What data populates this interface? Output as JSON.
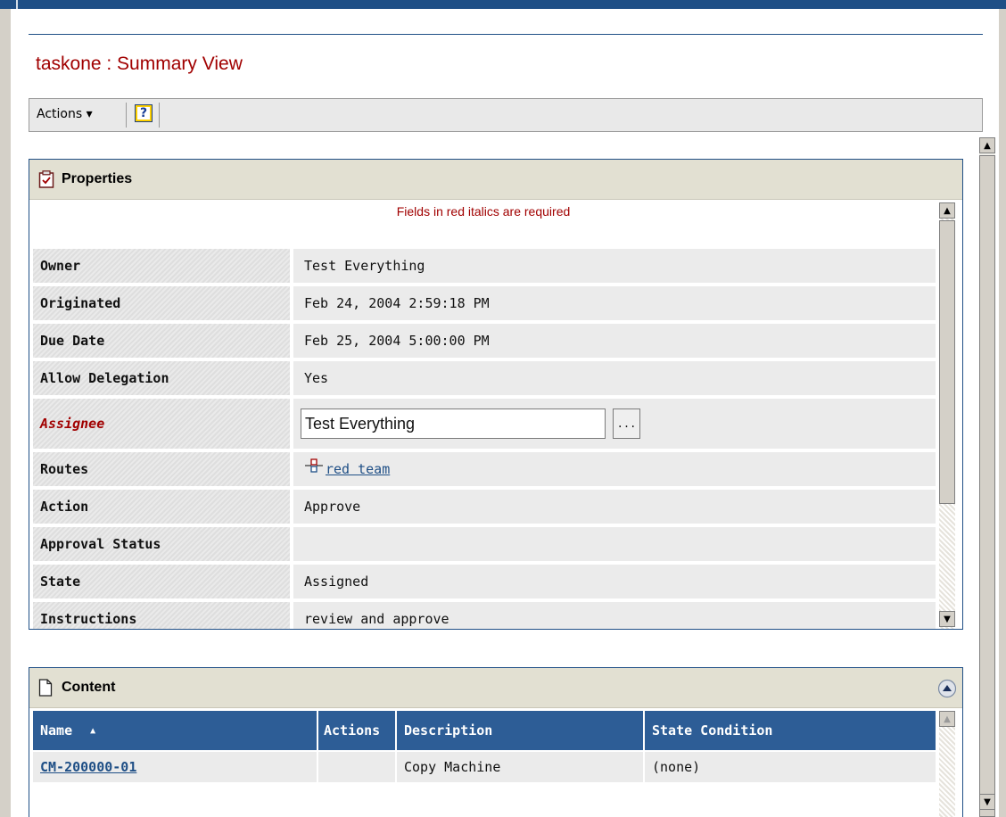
{
  "page": {
    "title": "taskone : Summary View"
  },
  "toolbar": {
    "actions_label": "Actions ▾",
    "help_label": "?"
  },
  "properties": {
    "title": "Properties",
    "required_note": "Fields in red italics are required",
    "rows": [
      {
        "label": "Owner",
        "value": "Test Everything"
      },
      {
        "label": "Originated",
        "value": "Feb 24, 2004 2:59:18 PM"
      },
      {
        "label": "Due Date",
        "value": "Feb 25, 2004 5:00:00 PM"
      },
      {
        "label": "Allow Delegation",
        "value": "Yes"
      },
      {
        "label": "Assignee",
        "value": "Test Everything",
        "required": true
      },
      {
        "label": "Routes",
        "value": "red team"
      },
      {
        "label": "Action",
        "value": "Approve"
      },
      {
        "label": "Approval Status",
        "value": ""
      },
      {
        "label": "State",
        "value": "Assigned"
      },
      {
        "label": "Instructions",
        "value": "review and approve"
      }
    ],
    "assignee_button": "..."
  },
  "content": {
    "title": "Content",
    "columns": [
      "Name",
      "Actions",
      "Description",
      "State Condition"
    ],
    "sort_indicator": "▲",
    "rows": [
      {
        "name": "CM-200000-01",
        "actions": "",
        "description": "Copy Machine",
        "state_condition": "(none)"
      }
    ]
  },
  "icons": {
    "properties": "clipboard-check-icon",
    "content": "document-icon",
    "collapse": "collapse-up-icon",
    "route": "route-icon"
  },
  "colors": {
    "title_red": "#a10000",
    "header_blue": "#2d5d96",
    "border_blue": "#1f4f86",
    "panel_head": "#e2e0d2"
  }
}
